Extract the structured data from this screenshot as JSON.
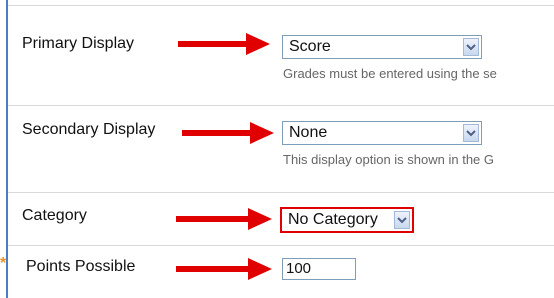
{
  "form": {
    "primary_display": {
      "label": "Primary Display",
      "value": "Score",
      "help": "Grades must be entered using the se"
    },
    "secondary_display": {
      "label": "Secondary Display",
      "value": "None",
      "help": "This display option is shown in the G"
    },
    "category": {
      "label": "Category",
      "value": "No Category"
    },
    "points_possible": {
      "label": "Points Possible",
      "value": "100",
      "required_marker": "*"
    }
  },
  "colors": {
    "arrow": "#e00000",
    "focus_outline": "#e00000",
    "frame": "#4a7fc8",
    "help_text": "#666666"
  },
  "icons": {
    "dropdown": "chevron-down-icon",
    "annotation": "red-arrow-icon",
    "required": "required-star-icon"
  }
}
